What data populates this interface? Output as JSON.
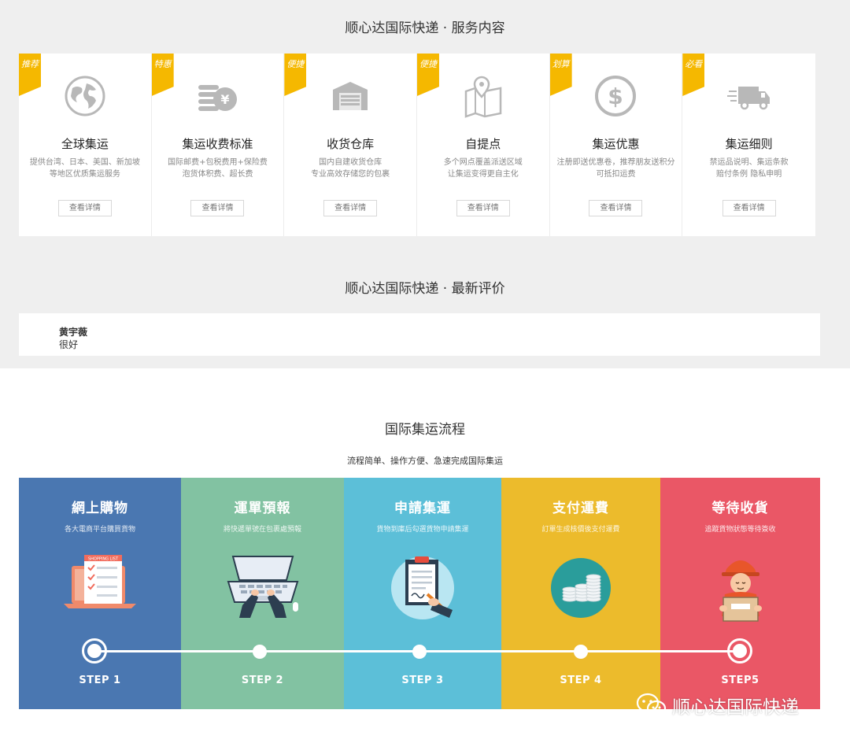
{
  "services_title": "顺心达国际快递 · 服务内容",
  "services": [
    {
      "tag": "推荐",
      "icon": "globe-icon",
      "title": "全球集运",
      "desc1": "提供台湾、日本、美国、新加坡",
      "desc2": "等地区优质集运服务",
      "button": "查看详情"
    },
    {
      "tag": "特惠",
      "icon": "yen-coins-icon",
      "title": "集运收费标准",
      "desc1": "国际邮费+包税费用+保险费",
      "desc2": "泡货体积费、超长费",
      "button": "查看详情"
    },
    {
      "tag": "便捷",
      "icon": "warehouse-icon",
      "title": "收货仓库",
      "desc1": "国内自建收货仓库",
      "desc2": "专业高效存储您的包裹",
      "button": "查看详情"
    },
    {
      "tag": "便捷",
      "icon": "map-pin-icon",
      "title": "自提点",
      "desc1": "多个网点覆盖派送区域",
      "desc2": "让集运变得更自主化",
      "button": "查看详情"
    },
    {
      "tag": "划算",
      "icon": "dollar-coin-icon",
      "title": "集运优惠",
      "desc1": "注册即送优惠卷，推荐朋友送积分",
      "desc2": "可抵扣运费",
      "button": "查看详情"
    },
    {
      "tag": "必看",
      "icon": "delivery-truck-icon",
      "title": "集运细则",
      "desc1": "禁运品说明、集运条款",
      "desc2": "赔付条例 隐私申明",
      "button": "查看详情"
    }
  ],
  "reviews_title": "顺心达国际快递 · 最新评价",
  "review": {
    "name": "黄宇薇",
    "text": "很好"
  },
  "process_title": "国际集运流程",
  "process_subtitle": "流程简单、操作方便、急速完成国际集运",
  "steps": [
    {
      "title": "網上購物",
      "desc": "各大電商平台購買貨物",
      "label": "STEP 1",
      "color": "#4a77b1"
    },
    {
      "title": "運單預報",
      "desc": "將快遞單號在包裹處預報",
      "label": "STEP 2",
      "color": "#82c2a2"
    },
    {
      "title": "申請集運",
      "desc": "貨物到庫后勾選貨物申請集運",
      "label": "STEP 3",
      "color": "#5cbfd8"
    },
    {
      "title": "支付運費",
      "desc": "訂單生成核價後支付運費",
      "label": "STEP 4",
      "color": "#ecbb2c"
    },
    {
      "title": "等待收貨",
      "desc": "追蹤貨物狀態等待簽收",
      "label": "STEP5",
      "color": "#ea5766"
    }
  ],
  "shopping_list_label": "SHOPPING LIST",
  "watermark": "顺心达国际快递"
}
